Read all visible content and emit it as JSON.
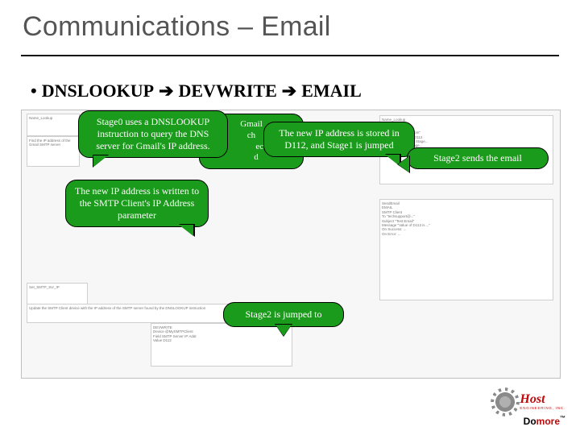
{
  "title": "Communications – Email",
  "bullet": {
    "text": "DNSLOOKUP",
    "arrow": "→",
    "mid": "DEVWRITE",
    "tail": "EMAIL"
  },
  "callouts": {
    "c1": "Stage0 uses a DNSLOOKUP instruction to query the DNS server for Gmail's IP address.",
    "c2": "The new IP address is written to the SMTP Client's IP Address parameter",
    "c3": "The new IP address is stored in D112, and Stage1 is jumped",
    "c4": "Stage2 sends the email",
    "c5": "Stage2 is jumped to",
    "c6a": "Gmail ",
    "c6b": "ch",
    "c6c": "ecu",
    "c6d": "d"
  },
  "bg": {
    "left_label_a": "Name_Lookup",
    "left_label_b": "Set_SMTP_Svr_IP",
    "rowtext1": "Find the IP address of the Gmail SMTP server",
    "rowtext2": "Update the SMTP Client device with the IP address of the SMTP server found by the DNSLOOKUP instruction",
    "block_right_top": "Name_Lookup\nDNSLOOKUP\nDNS Server\nName  \"smtp.gmail.com\"\nIP Address Storage D112\nOn Success: JMP to Stage...\nOn Error: JMP to Stage...",
    "block_right_mid": "SendEmail\nEMAIL\nSMTP Client\nTo \"techsupport@...\"\nSubject \"Test Email\"\nMessage \"Value of D113 is ...\"\nOn Success: ...\nOn Error: ...",
    "devwrite": "DEVWRITE\nDevice @MySMTPClient\nField SMTP Server IP Addr\nValue D112"
  },
  "logo": {
    "host": "Host",
    "sub": "ENGINEERING, INC.",
    "brand_do": "Do",
    "brand_more": "more",
    "tm": "™"
  }
}
